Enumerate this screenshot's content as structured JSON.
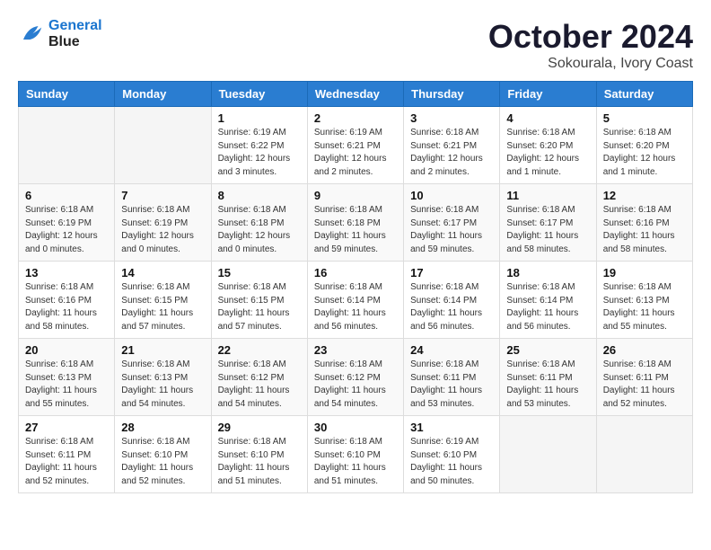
{
  "header": {
    "logo_line1": "General",
    "logo_line2": "Blue",
    "month": "October 2024",
    "location": "Sokourala, Ivory Coast"
  },
  "weekdays": [
    "Sunday",
    "Monday",
    "Tuesday",
    "Wednesday",
    "Thursday",
    "Friday",
    "Saturday"
  ],
  "weeks": [
    [
      {
        "day": "",
        "info": ""
      },
      {
        "day": "",
        "info": ""
      },
      {
        "day": "1",
        "info": "Sunrise: 6:19 AM\nSunset: 6:22 PM\nDaylight: 12 hours\nand 3 minutes."
      },
      {
        "day": "2",
        "info": "Sunrise: 6:19 AM\nSunset: 6:21 PM\nDaylight: 12 hours\nand 2 minutes."
      },
      {
        "day": "3",
        "info": "Sunrise: 6:18 AM\nSunset: 6:21 PM\nDaylight: 12 hours\nand 2 minutes."
      },
      {
        "day": "4",
        "info": "Sunrise: 6:18 AM\nSunset: 6:20 PM\nDaylight: 12 hours\nand 1 minute."
      },
      {
        "day": "5",
        "info": "Sunrise: 6:18 AM\nSunset: 6:20 PM\nDaylight: 12 hours\nand 1 minute."
      }
    ],
    [
      {
        "day": "6",
        "info": "Sunrise: 6:18 AM\nSunset: 6:19 PM\nDaylight: 12 hours\nand 0 minutes."
      },
      {
        "day": "7",
        "info": "Sunrise: 6:18 AM\nSunset: 6:19 PM\nDaylight: 12 hours\nand 0 minutes."
      },
      {
        "day": "8",
        "info": "Sunrise: 6:18 AM\nSunset: 6:18 PM\nDaylight: 12 hours\nand 0 minutes."
      },
      {
        "day": "9",
        "info": "Sunrise: 6:18 AM\nSunset: 6:18 PM\nDaylight: 11 hours\nand 59 minutes."
      },
      {
        "day": "10",
        "info": "Sunrise: 6:18 AM\nSunset: 6:17 PM\nDaylight: 11 hours\nand 59 minutes."
      },
      {
        "day": "11",
        "info": "Sunrise: 6:18 AM\nSunset: 6:17 PM\nDaylight: 11 hours\nand 58 minutes."
      },
      {
        "day": "12",
        "info": "Sunrise: 6:18 AM\nSunset: 6:16 PM\nDaylight: 11 hours\nand 58 minutes."
      }
    ],
    [
      {
        "day": "13",
        "info": "Sunrise: 6:18 AM\nSunset: 6:16 PM\nDaylight: 11 hours\nand 58 minutes."
      },
      {
        "day": "14",
        "info": "Sunrise: 6:18 AM\nSunset: 6:15 PM\nDaylight: 11 hours\nand 57 minutes."
      },
      {
        "day": "15",
        "info": "Sunrise: 6:18 AM\nSunset: 6:15 PM\nDaylight: 11 hours\nand 57 minutes."
      },
      {
        "day": "16",
        "info": "Sunrise: 6:18 AM\nSunset: 6:14 PM\nDaylight: 11 hours\nand 56 minutes."
      },
      {
        "day": "17",
        "info": "Sunrise: 6:18 AM\nSunset: 6:14 PM\nDaylight: 11 hours\nand 56 minutes."
      },
      {
        "day": "18",
        "info": "Sunrise: 6:18 AM\nSunset: 6:14 PM\nDaylight: 11 hours\nand 56 minutes."
      },
      {
        "day": "19",
        "info": "Sunrise: 6:18 AM\nSunset: 6:13 PM\nDaylight: 11 hours\nand 55 minutes."
      }
    ],
    [
      {
        "day": "20",
        "info": "Sunrise: 6:18 AM\nSunset: 6:13 PM\nDaylight: 11 hours\nand 55 minutes."
      },
      {
        "day": "21",
        "info": "Sunrise: 6:18 AM\nSunset: 6:13 PM\nDaylight: 11 hours\nand 54 minutes."
      },
      {
        "day": "22",
        "info": "Sunrise: 6:18 AM\nSunset: 6:12 PM\nDaylight: 11 hours\nand 54 minutes."
      },
      {
        "day": "23",
        "info": "Sunrise: 6:18 AM\nSunset: 6:12 PM\nDaylight: 11 hours\nand 54 minutes."
      },
      {
        "day": "24",
        "info": "Sunrise: 6:18 AM\nSunset: 6:11 PM\nDaylight: 11 hours\nand 53 minutes."
      },
      {
        "day": "25",
        "info": "Sunrise: 6:18 AM\nSunset: 6:11 PM\nDaylight: 11 hours\nand 53 minutes."
      },
      {
        "day": "26",
        "info": "Sunrise: 6:18 AM\nSunset: 6:11 PM\nDaylight: 11 hours\nand 52 minutes."
      }
    ],
    [
      {
        "day": "27",
        "info": "Sunrise: 6:18 AM\nSunset: 6:11 PM\nDaylight: 11 hours\nand 52 minutes."
      },
      {
        "day": "28",
        "info": "Sunrise: 6:18 AM\nSunset: 6:10 PM\nDaylight: 11 hours\nand 52 minutes."
      },
      {
        "day": "29",
        "info": "Sunrise: 6:18 AM\nSunset: 6:10 PM\nDaylight: 11 hours\nand 51 minutes."
      },
      {
        "day": "30",
        "info": "Sunrise: 6:18 AM\nSunset: 6:10 PM\nDaylight: 11 hours\nand 51 minutes."
      },
      {
        "day": "31",
        "info": "Sunrise: 6:19 AM\nSunset: 6:10 PM\nDaylight: 11 hours\nand 50 minutes."
      },
      {
        "day": "",
        "info": ""
      },
      {
        "day": "",
        "info": ""
      }
    ]
  ]
}
